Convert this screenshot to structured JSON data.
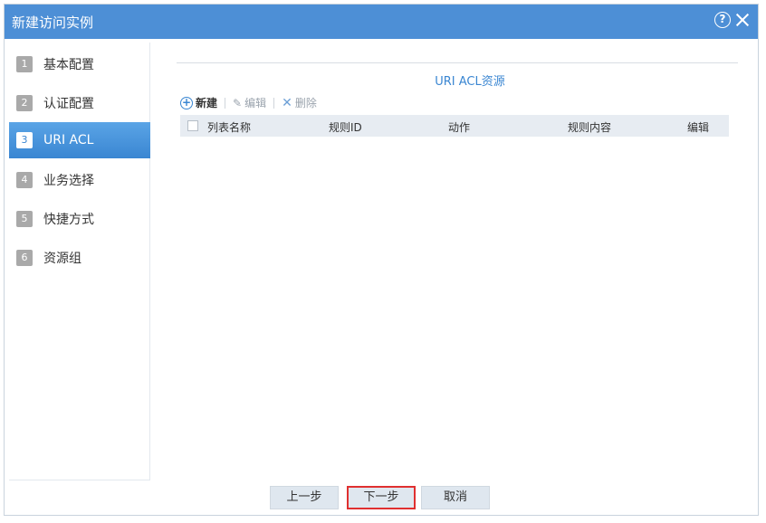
{
  "dialog": {
    "title": "新建访问实例",
    "help_glyph": "?"
  },
  "sidebar": {
    "steps": [
      {
        "num": "1",
        "label": "基本配置"
      },
      {
        "num": "2",
        "label": "认证配置"
      },
      {
        "num": "3",
        "label": "URI ACL",
        "active": true
      },
      {
        "num": "4",
        "label": "业务选择"
      },
      {
        "num": "5",
        "label": "快捷方式"
      },
      {
        "num": "6",
        "label": "资源组"
      }
    ]
  },
  "main": {
    "section_title": "URI ACL资源",
    "toolbar": {
      "new_label": "新建",
      "edit_label": "编辑",
      "delete_label": "删除"
    },
    "table": {
      "columns": [
        "列表名称",
        "规则ID",
        "动作",
        "规则内容",
        "编辑"
      ],
      "rows": []
    }
  },
  "footer": {
    "prev_label": "上一步",
    "next_label": "下一步",
    "cancel_label": "取消"
  },
  "colors": {
    "titlebar": "#4d8fd6",
    "active_step": "#3a86d2",
    "highlight_border": "#e03030"
  }
}
